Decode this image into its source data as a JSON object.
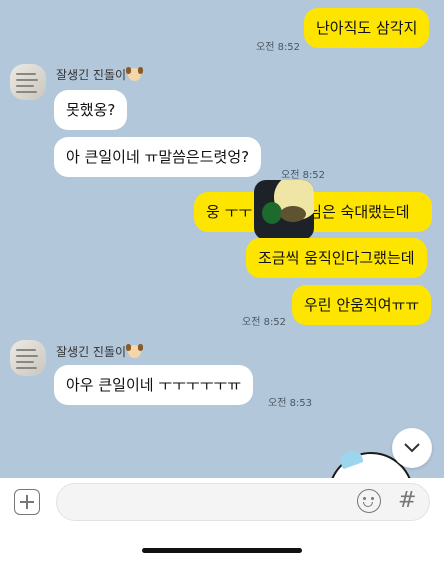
{
  "messages": [
    {
      "type": "out",
      "text": "난아직도 삼각지",
      "time": "오전 8:52"
    },
    {
      "type": "in",
      "sender": "잘생긴 진돌이",
      "text": "못했옹?"
    },
    {
      "type": "in",
      "text": "아 큰일이네 ㅠ말씀은드렷엉?",
      "time": "오전 8:52"
    },
    {
      "type": "out",
      "text_left": "웅 ㅜㅜ",
      "text_right": "님은 숙대랬는데"
    },
    {
      "type": "out",
      "text": "조금씩 움직인다그랬는데"
    },
    {
      "type": "out",
      "text": "우린 안움직여ㅠㅠ",
      "time": "오전 8:52"
    },
    {
      "type": "in",
      "sender": "잘생긴 진돌이",
      "text": "아우 큰일이네 ㅜㅜㅜㅜㅜㅠ",
      "time": "오전 8:53"
    }
  ],
  "input": {
    "placeholder": ""
  },
  "icons": {
    "scroll_down": "chevron-down-icon",
    "attach": "plus-icon",
    "emoji": "emoji-icon",
    "hashtag": "hashtag-icon"
  },
  "colors": {
    "chat_bg": "#b2c7da",
    "outgoing": "#fee500",
    "incoming": "#ffffff"
  }
}
